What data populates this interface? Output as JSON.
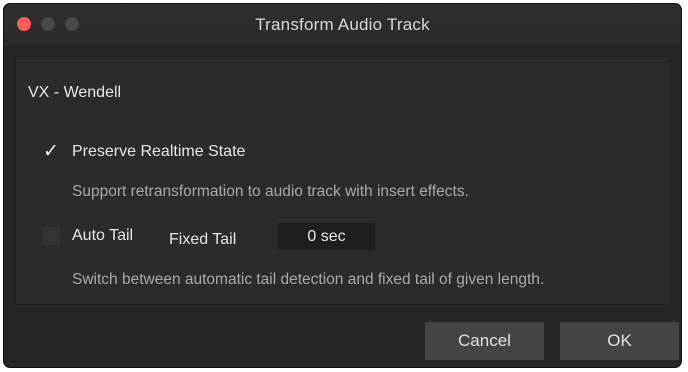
{
  "window": {
    "title": "Transform Audio Track"
  },
  "track": {
    "name": "VX - Wendell"
  },
  "options": {
    "preserve_realtime": {
      "label": "Preserve Realtime State",
      "checked": true,
      "description": "Support retransformation to audio track with insert effects."
    },
    "auto_tail": {
      "label": "Auto Tail",
      "checked": false,
      "fixed_tail_label": "Fixed Tail",
      "fixed_tail_value": "0 sec",
      "description": "Switch between automatic tail detection and fixed tail of given length."
    }
  },
  "checkmark_glyph": "✓",
  "buttons": {
    "cancel": "Cancel",
    "ok": "OK"
  },
  "colors": {
    "close_button": "#fc5f57",
    "window_bg": "#262626",
    "panel_bg": "#2b2b2b",
    "button_bg": "#444444"
  }
}
